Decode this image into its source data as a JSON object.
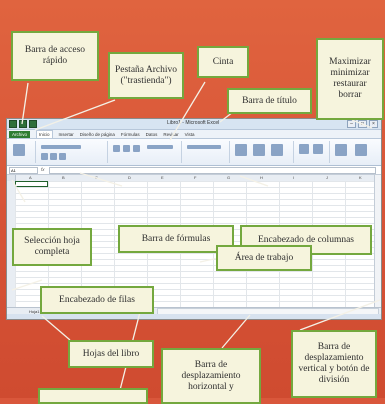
{
  "colors": {
    "background": "#d9573b",
    "callout_fill": "#f6f4dd",
    "callout_border": "#74a83e",
    "excel_green": "#2f7d32"
  },
  "excel": {
    "doc_title": "Libro1 - Microsoft Excel",
    "tabs": [
      "Archivo",
      "Inicio",
      "Insertar",
      "Diseño de página",
      "Fórmulas",
      "Datos",
      "Revisar",
      "Vista"
    ],
    "name_box": "A1",
    "fx_label": "fx",
    "columns": [
      "A",
      "B",
      "C",
      "D",
      "E",
      "F",
      "G",
      "H",
      "I",
      "J",
      "K"
    ],
    "sheet_tabs": [
      "Hoja1",
      "Hoja2",
      "Hoja3"
    ],
    "window_buttons": [
      "–",
      "□",
      "×"
    ]
  },
  "callouts": {
    "quick_access": "Barra de acceso rápido",
    "file_tab": "Pestaña Archivo (\"trastienda\")",
    "ribbon": "Cinta",
    "window_controls": "Maximizar minimizar restaurar borrar",
    "title_bar": "Barra de título",
    "select_all": "Selección hoja completa",
    "formula_bar": "Barra de fórmulas",
    "column_headers": "Encabezado de columnas",
    "work_area": "Área de trabajo",
    "row_headers": "Encabezado de filas",
    "sheet_tabs": "Hojas del libro",
    "h_scroll": "Barra de desplazamiento horizontal y",
    "v_scroll": "Barra de desplazamiento vertical y botón de división"
  }
}
